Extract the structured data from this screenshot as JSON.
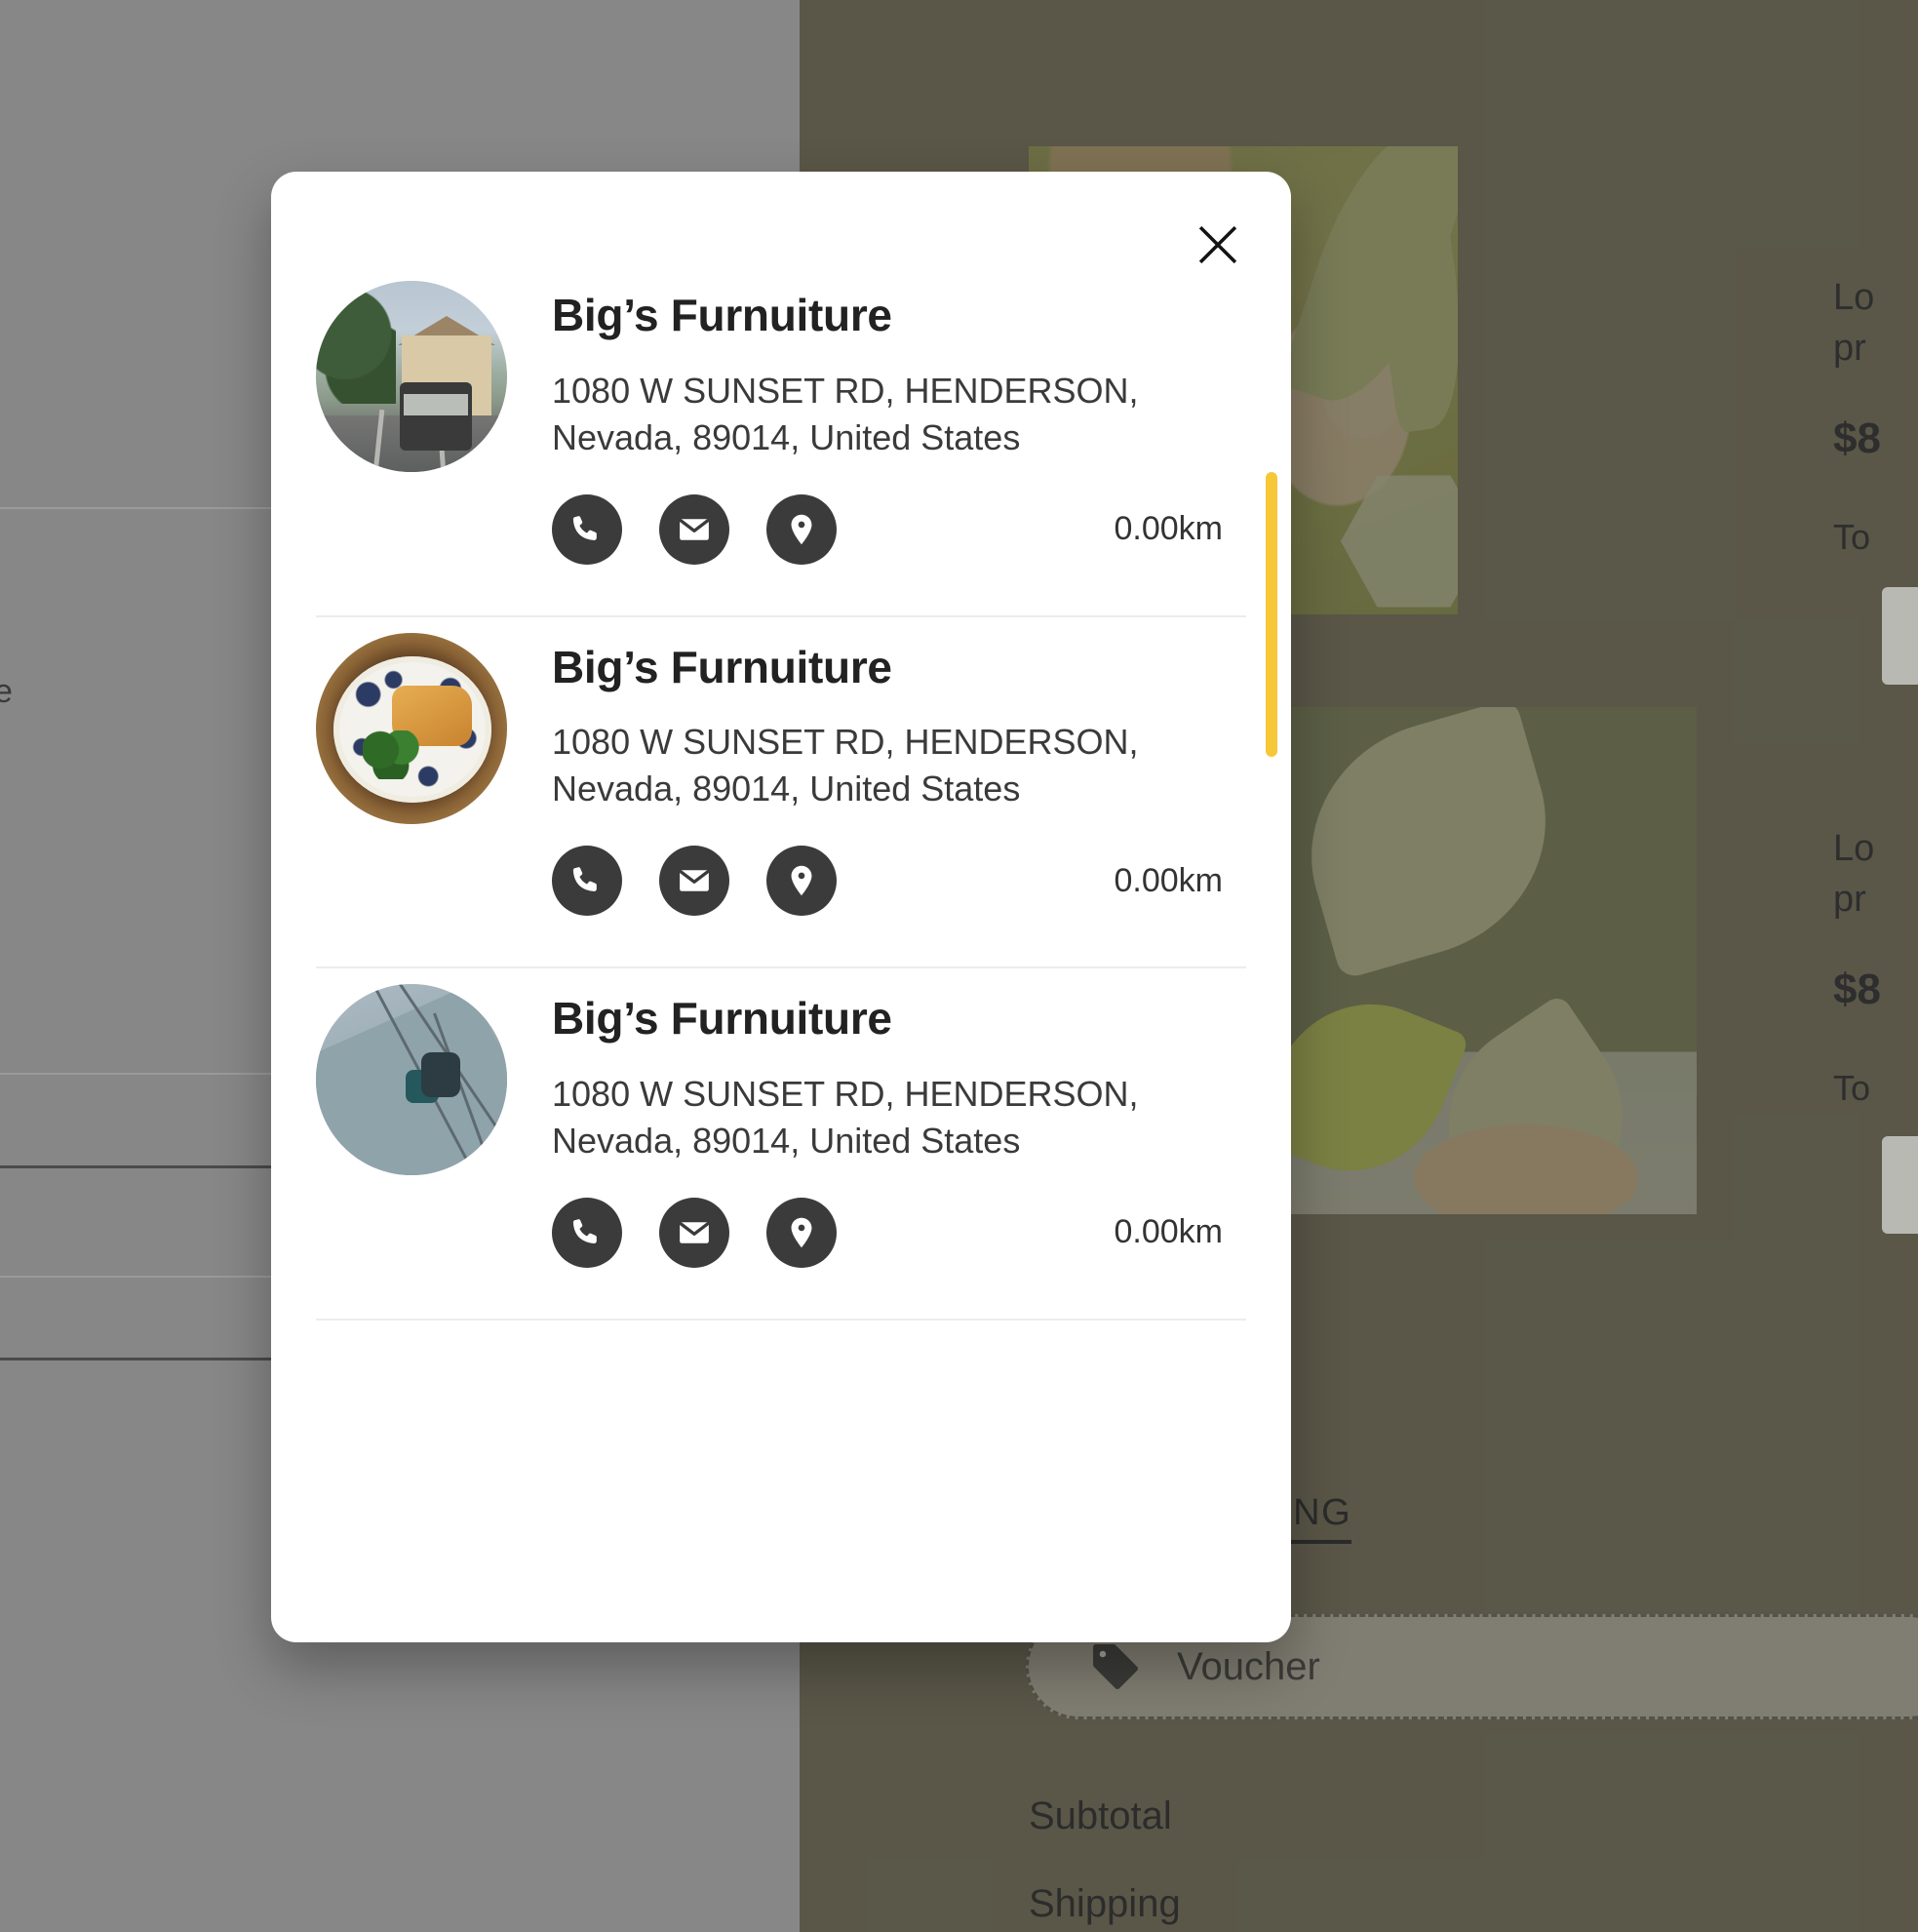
{
  "modal": {
    "close_label": "Close",
    "close_icon": "close-icon",
    "scrollbar_color": "#f6c737",
    "stores": [
      {
        "name": "Big’s Furnuiture",
        "address": "1080 W SUNSET RD, HENDERSON, Nevada, 89014, United States",
        "distance": "0.00km",
        "avatar_alt": "street-with-cable-car-photo",
        "actions": [
          {
            "icon": "phone-icon",
            "label": "Call store"
          },
          {
            "icon": "envelope-icon",
            "label": "Email store"
          },
          {
            "icon": "location-pin-icon",
            "label": "View on map"
          }
        ]
      },
      {
        "name": "Big’s Furnuiture",
        "address": "1080 W SUNSET RD, HENDERSON, Nevada, 89014, United States",
        "distance": "0.00km",
        "avatar_alt": "food-bowl-photo",
        "actions": [
          {
            "icon": "phone-icon",
            "label": "Call store"
          },
          {
            "icon": "envelope-icon",
            "label": "Email store"
          },
          {
            "icon": "location-pin-icon",
            "label": "View on map"
          }
        ]
      },
      {
        "name": "Big’s Furnuiture",
        "address": "1080 W SUNSET RD, HENDERSON, Nevada, 89014, United States",
        "distance": "0.00km",
        "avatar_alt": "sail-climbers-photo",
        "actions": [
          {
            "icon": "phone-icon",
            "label": "Call store"
          },
          {
            "icon": "envelope-icon",
            "label": "Email store"
          },
          {
            "icon": "location-pin-icon",
            "label": "View on map"
          }
        ]
      }
    ]
  },
  "background": {
    "left_fragment_text": "e",
    "cart_items": [
      {
        "title_line1": "Lo",
        "title_line2": "pr",
        "price": "$8",
        "total_label": "To"
      },
      {
        "title_line1": "Lo",
        "title_line2": "pr",
        "price": "$8",
        "total_label": "To"
      }
    ],
    "shipping_tab": "PING",
    "voucher": {
      "label": "Voucher",
      "icon": "tag-icon"
    },
    "summary": [
      {
        "label": "Subtotal"
      },
      {
        "label": "Shipping"
      }
    ]
  }
}
